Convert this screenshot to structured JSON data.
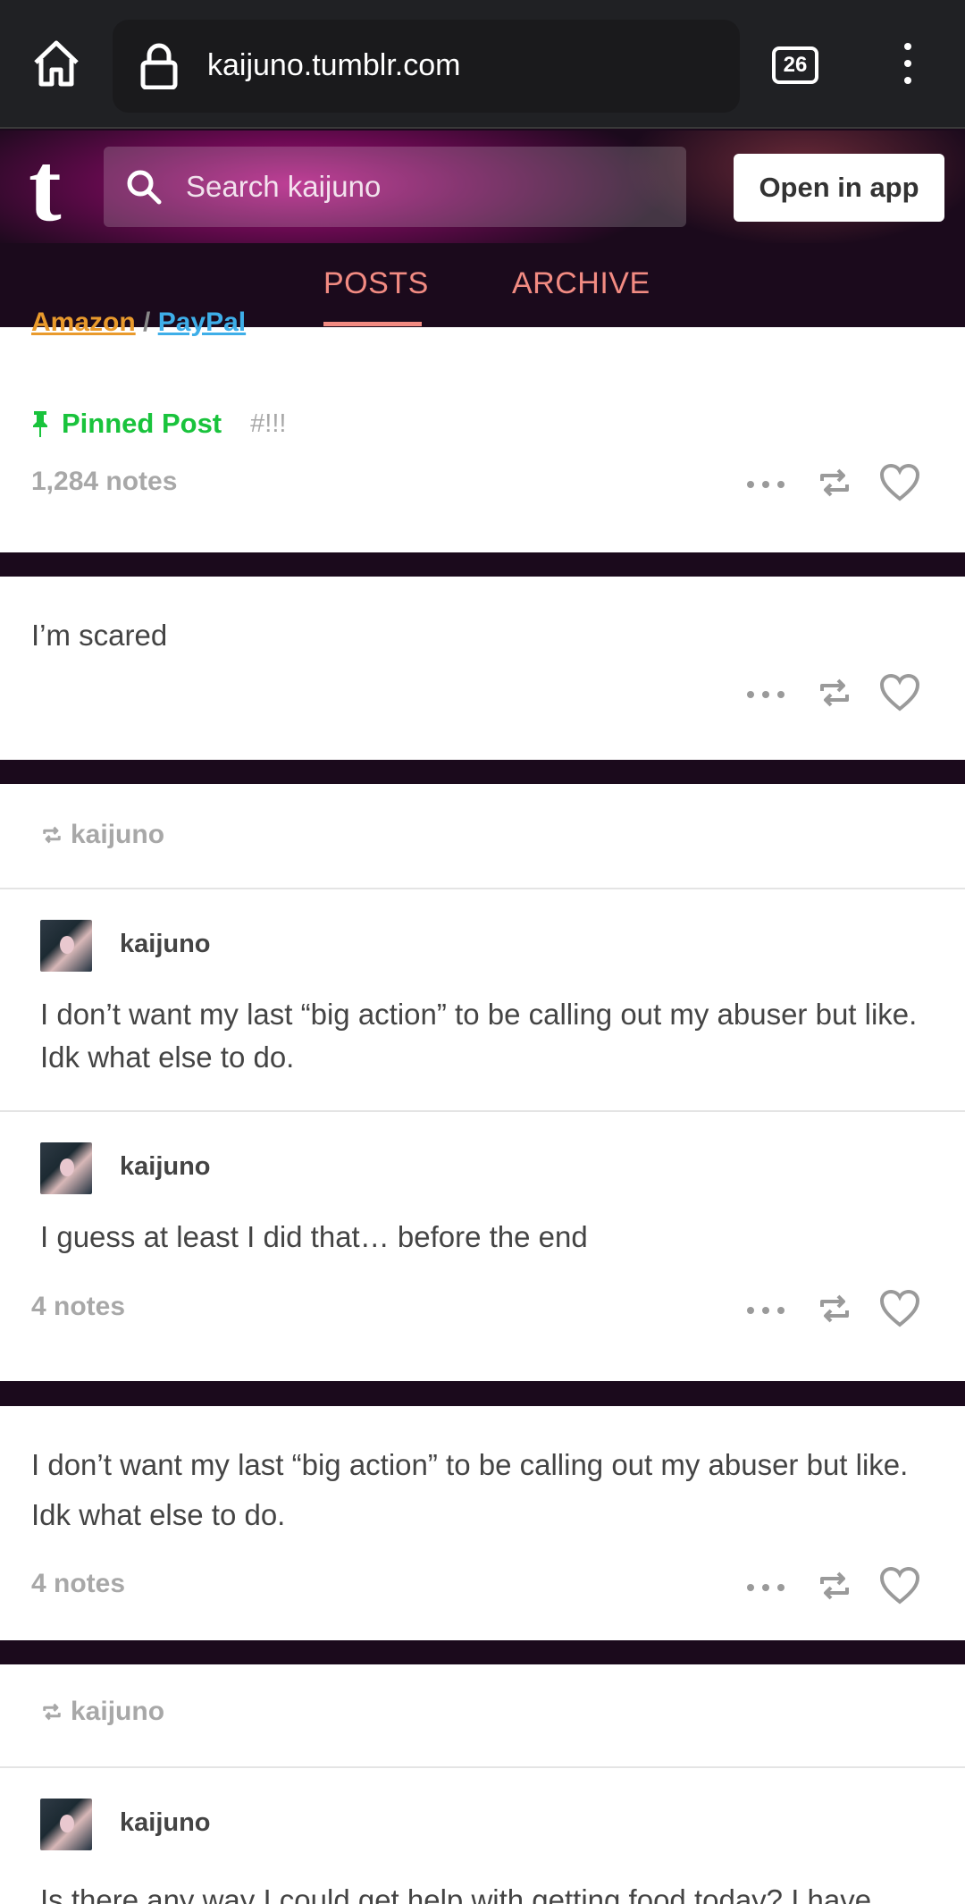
{
  "browser": {
    "url": "kaijuno.tumblr.com",
    "tab_count": "26"
  },
  "header": {
    "search_placeholder": "Search kaijuno",
    "open_app_label": "Open in app"
  },
  "nav": {
    "tabs": [
      {
        "label": "POSTS",
        "active": true
      },
      {
        "label": "ARCHIVE",
        "active": false
      }
    ]
  },
  "pinned_post": {
    "partial_links": [
      "Amazon",
      "PayPal"
    ],
    "pinned_label": "Pinned Post",
    "tag": "#!!!",
    "notes": "1,284 notes"
  },
  "post2": {
    "text": "I’m scared"
  },
  "post3": {
    "reblogged_by": "kaijuno",
    "trail": [
      {
        "user": "kaijuno",
        "text": "I don’t want my last “big action” to be calling out my abuser but like. Idk what else to do."
      },
      {
        "user": "kaijuno",
        "text": "I guess at least I did that… before the end"
      }
    ],
    "notes": "4 notes"
  },
  "post4": {
    "text": "I don’t want my last “big action” to be calling out my abuser but like. Idk what else to do.",
    "notes": "4 notes"
  },
  "post5": {
    "reblogged_by": "kaijuno",
    "trail_user": "kaijuno",
    "trail_text": "Is there any way I could get help with getting food today? I have"
  },
  "colors": {
    "page_bg": "#1b0a1c",
    "nav_accent": "#f28b82",
    "pinned_green": "#19c33c",
    "link_orange": "#e99a2c",
    "link_blue": "#3eaee8"
  }
}
